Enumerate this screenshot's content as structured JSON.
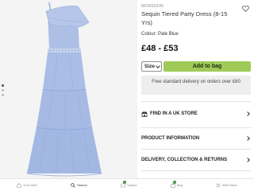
{
  "product": {
    "brand": "MONSOON",
    "title": "Sequin Tiered Party Dress (8-15 Yrs)",
    "colour": "Colour: Pale Blue",
    "price": "£48 - £53",
    "size_label": "Size",
    "add_to_bag": "Add to bag",
    "delivery_note": "Free standard delivery on orders over £60",
    "image_count": 3,
    "active_image": 1
  },
  "accordion": [
    {
      "label": "FIND IN A UK STORE",
      "icon": "store-icon"
    },
    {
      "label": "PRODUCT INFORMATION",
      "icon": null
    },
    {
      "label": "DELIVERY, COLLECTION & RETURNS",
      "icon": null
    }
  ],
  "bottom_nav": [
    {
      "label": "Your M&S",
      "icon": "home-icon",
      "badge": ""
    },
    {
      "label": "Search",
      "icon": "search-icon",
      "badge": ""
    },
    {
      "label": "Sparks",
      "icon": "sparks-icon",
      "badge": "1"
    },
    {
      "label": "Bag",
      "icon": "bag-icon",
      "badge": "1"
    },
    {
      "label": "M&S More",
      "icon": "menu-icon",
      "badge": ""
    }
  ],
  "colors": {
    "accent_green": "#9fca58",
    "dress_blue": "#a9bde6",
    "badge_green": "#2f8a3b"
  }
}
